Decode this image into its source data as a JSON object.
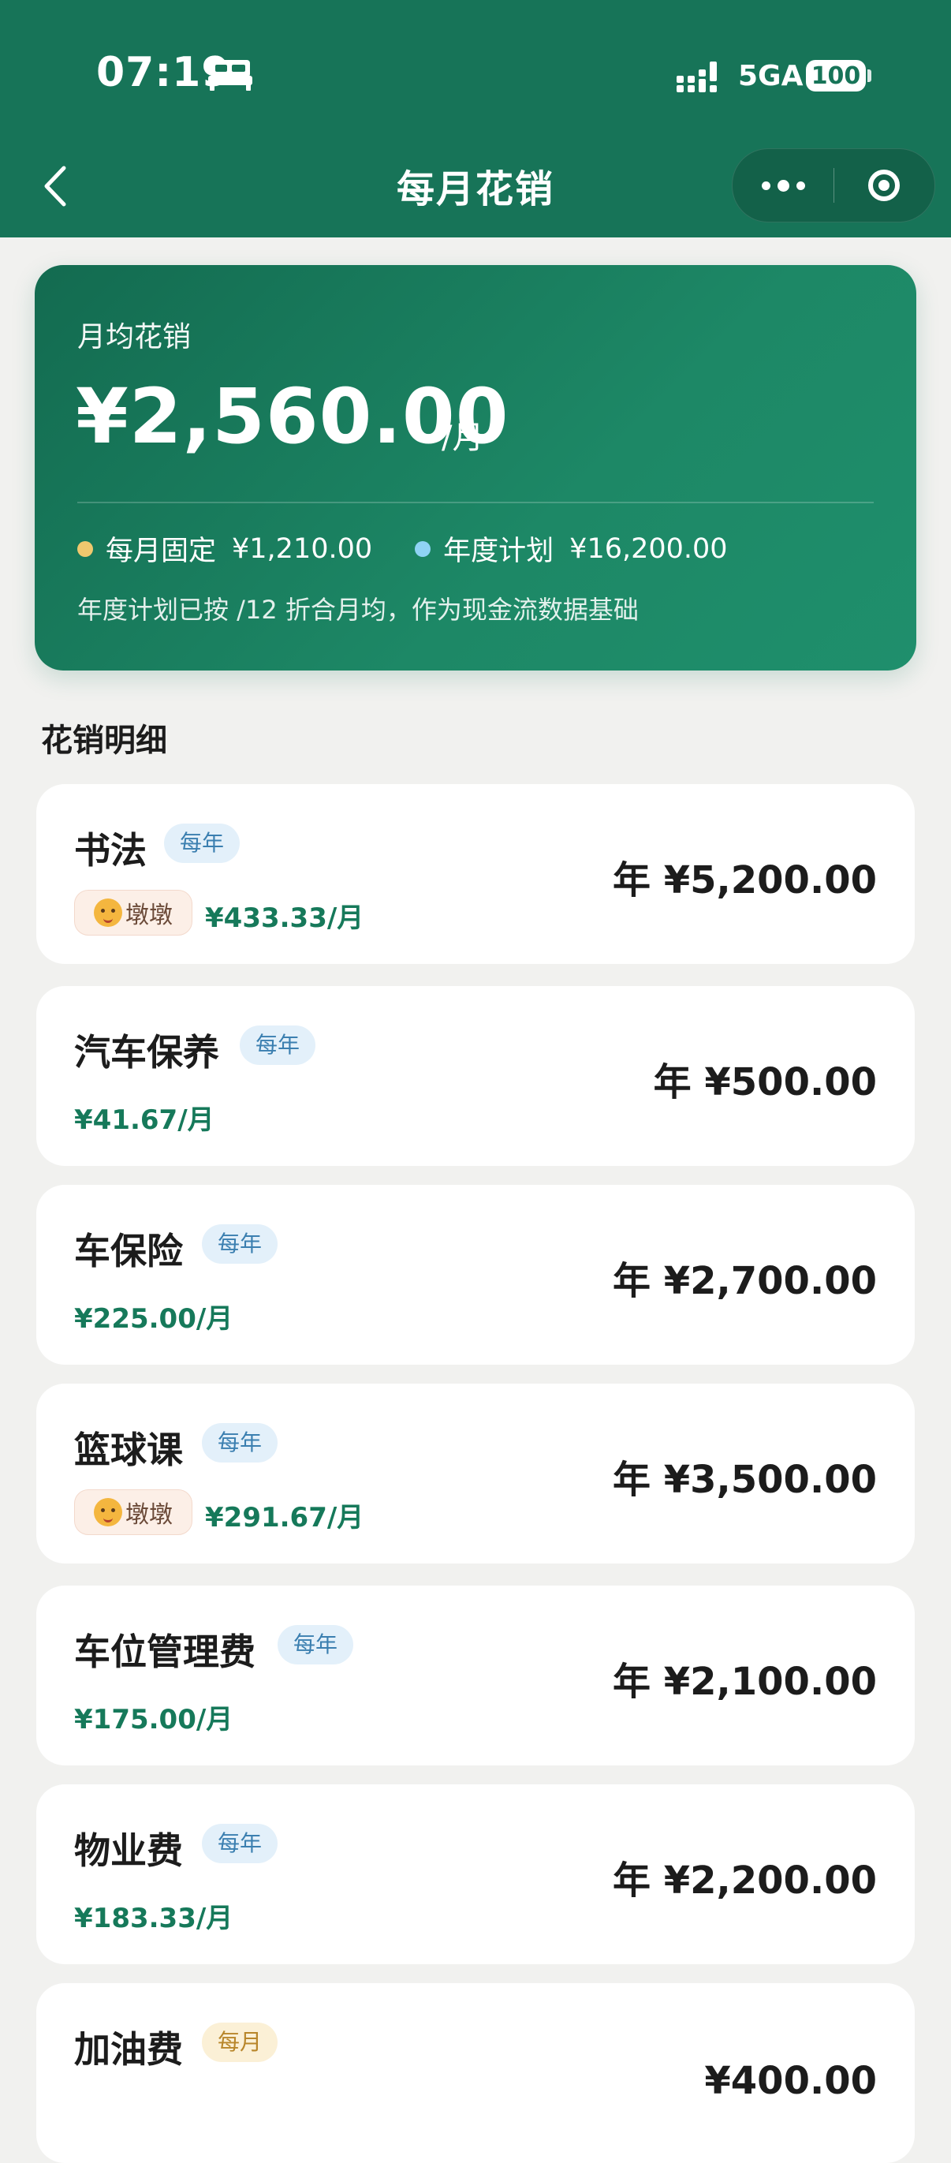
{
  "status_bar": {
    "time": "07:19",
    "network": "5GA",
    "battery": "100"
  },
  "nav": {
    "title": "每月花销"
  },
  "summary": {
    "label": "月均花销",
    "amount": "¥2,560.00",
    "unit": "/月",
    "legend": [
      {
        "label": "每月固定",
        "value": "¥1,210.00",
        "color": "#f0c86e"
      },
      {
        "label": "年度计划",
        "value": "¥16,200.00",
        "color": "#8fd3f4"
      }
    ],
    "note": "年度计划已按 /12 折合月均，作为现金流数据基础"
  },
  "section": {
    "title": "花销明细"
  },
  "items": [
    {
      "name": "书法",
      "badge": "每年",
      "member": "墩墩",
      "monthly": "¥433.33/月",
      "annual": "年 ¥5,200.00"
    },
    {
      "name": "汽车保养",
      "badge": "每年",
      "monthly": "¥41.67/月",
      "annual": "年 ¥500.00"
    },
    {
      "name": "车保险",
      "badge": "每年",
      "monthly": "¥225.00/月",
      "annual": "年 ¥2,700.00"
    },
    {
      "name": "篮球课",
      "badge": "每年",
      "member": "墩墩",
      "monthly": "¥291.67/月",
      "annual": "年 ¥3,500.00"
    },
    {
      "name": "车位管理费",
      "badge": "每年",
      "monthly": "¥175.00/月",
      "annual": "年 ¥2,100.00"
    },
    {
      "name": "物业费",
      "badge": "每年",
      "monthly": "¥183.33/月",
      "annual": "年 ¥2,200.00"
    },
    {
      "name": "加油费",
      "badge": "每月",
      "annual": "¥400.00"
    }
  ]
}
